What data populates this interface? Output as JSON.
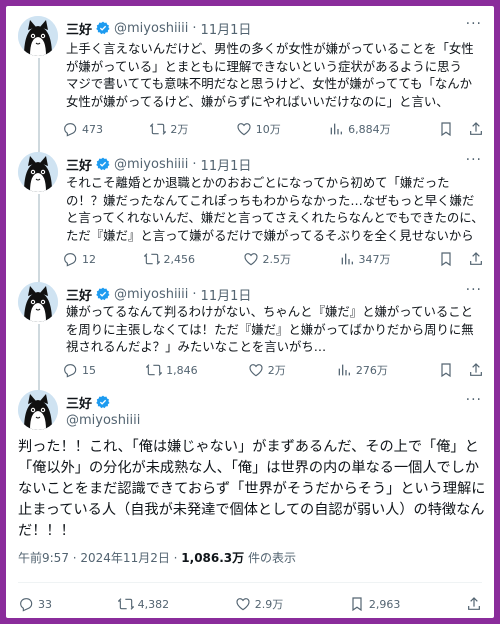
{
  "author": {
    "name": "三好",
    "handle": "@miyoshiiii"
  },
  "separator": "·",
  "replies": [
    {
      "date": "11月1日",
      "text": "上手く言えないんだけど、男性の多くが女性が嫌がっていることを「女性が嫌がっている」とまともに理解できないという症状があるように思う　マジで書いてても意味不明だなと思うけど、女性が嫌がってても「なんか女性が嫌がってるけど、嫌がらずにやればいいだけなのに」と言い、",
      "stats": {
        "replies": "473",
        "retweets": "2万",
        "likes": "10万",
        "views": "6,884万"
      }
    },
    {
      "date": "11月1日",
      "text": "それこそ離婚とか退職とかのおおごとになってから初めて「嫌だったの！？嫌だったなんてこれぽっちもわからなかった…なぜもっと早く嫌だと言ってくれないんだ、嫌だと言ってさえくれたらなんとでもできたのに、ただ『嫌だ』と言って嫌がるだけで嫌がってるそぶりを全く見せないから",
      "stats": {
        "replies": "12",
        "retweets": "2,456",
        "likes": "2.5万",
        "views": "347万"
      }
    },
    {
      "date": "11月1日",
      "text": "嫌がってるなんて判るわけがない、ちゃんと『嫌だ』と嫌がっていることを周りに主張しなくては！ただ『嫌だ』と嫌がってばかりだから周りに無視されるんだよ？」みたいなことを言いがち…",
      "stats": {
        "replies": "15",
        "retweets": "1,846",
        "likes": "2万",
        "views": "276万"
      }
    }
  ],
  "main": {
    "text": "判った！！これ、「俺は嫌じゃない」がまずあるんだ、その上で「俺」と「俺以外」の分化が未成熟な人、「俺」は世界の内の単なる一個人でしかないことをまだ認識できておらず「世界がそうだからそう」という理解に止まっている人（自我が未発達で個体としての自認が弱い人）の特徴なんだ！！！",
    "time": "午前9:57 · 2024年11月2日 · ",
    "views_count": "1,086.3万",
    "views_label": " 件の表示",
    "stats": {
      "replies": "33",
      "retweets": "4,382",
      "likes": "2.9万",
      "bookmarks": "2,963"
    }
  },
  "colors": {
    "verified": "#1d9bf0",
    "secondary": "#536471",
    "border": "#8a2c9b"
  },
  "icons": [
    "reply-icon",
    "retweet-icon",
    "like-icon",
    "views-icon",
    "bookmark-icon",
    "share-icon",
    "verified-icon",
    "more-icon"
  ]
}
